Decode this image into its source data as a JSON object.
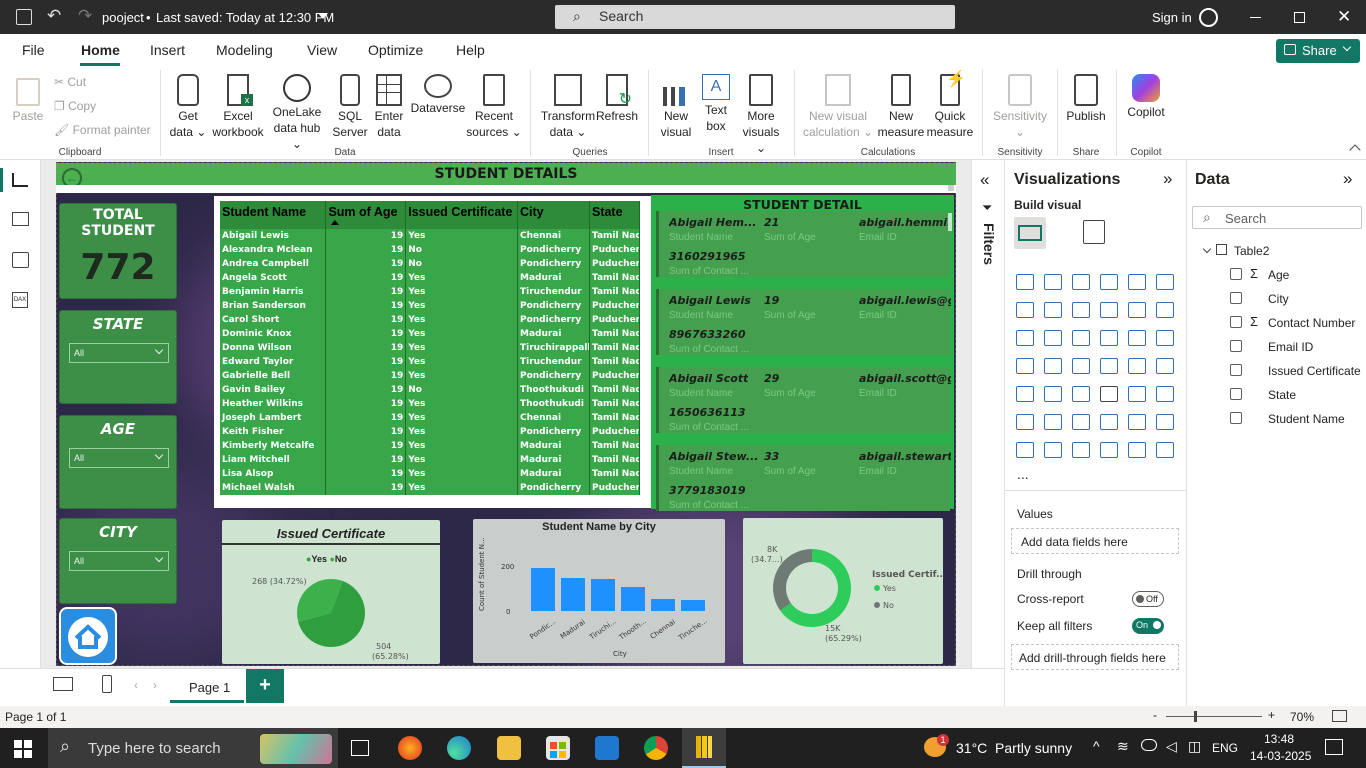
{
  "titlebar": {
    "file_name": "poojeсt",
    "saved_status": "Last saved: Today at 12:30 PM",
    "search_placeholder": "Search",
    "sign_in": "Sign in"
  },
  "menu": {
    "tabs": [
      "File",
      "Home",
      "Insert",
      "Modeling",
      "View",
      "Optimize",
      "Help"
    ],
    "active_tab": "Home",
    "share_label": "Share"
  },
  "ribbon": {
    "clipboard": {
      "paste": "Paste",
      "cut": "Cut",
      "copy": "Copy",
      "format_painter": "Format painter",
      "group": "Clipboard"
    },
    "data": {
      "get_data": [
        "Get",
        "data"
      ],
      "excel": [
        "Excel",
        "workbook"
      ],
      "onelake": [
        "OneLake",
        "data hub"
      ],
      "sql": [
        "SQL",
        "Server"
      ],
      "enter": [
        "Enter",
        "data"
      ],
      "dataverse": [
        "Dataverse"
      ],
      "recent": [
        "Recent",
        "sources"
      ],
      "group": "Data"
    },
    "queries": {
      "transform": [
        "Transform",
        "data"
      ],
      "refresh": [
        "Refresh"
      ],
      "group": "Queries"
    },
    "insert": {
      "new_visual": [
        "New",
        "visual"
      ],
      "text_box": [
        "Text",
        "box"
      ],
      "more_visuals": [
        "More",
        "visuals"
      ],
      "group": "Insert"
    },
    "calculations": {
      "new_visual_calc": [
        "New visual",
        "calculation"
      ],
      "new_measure": [
        "New",
        "measure"
      ],
      "quick_measure": [
        "Quick",
        "measure"
      ],
      "group": "Calculations"
    },
    "sensitivity": {
      "label": [
        "Sensitivity"
      ],
      "group": "Sensitivity"
    },
    "share": {
      "publish": [
        "Publish"
      ],
      "group": "Share"
    },
    "copilot": {
      "label": [
        "Copilot"
      ],
      "group": "Copilot"
    }
  },
  "report": {
    "header_title": "STUDENT DETAILS",
    "total_card": {
      "title_line1": "TOTAL",
      "title_line2": "STUDENT",
      "value": "772"
    },
    "slicers": [
      {
        "title": "STATE",
        "value": "All"
      },
      {
        "title": "AGE",
        "value": "All"
      },
      {
        "title": "CITY",
        "value": "All"
      }
    ],
    "table": {
      "columns": [
        "Student Name",
        "Sum of Age",
        "Issued Certificate",
        "City",
        "State"
      ],
      "rows": [
        [
          "Abigail Lewis",
          "19",
          "Yes",
          "Chennai",
          "Tamil Nadu"
        ],
        [
          "Alexandra Mclean",
          "19",
          "No",
          "Pondicherry",
          "Puducherry"
        ],
        [
          "Andrea Campbell",
          "19",
          "No",
          "Pondicherry",
          "Puducherry"
        ],
        [
          "Angela Scott",
          "19",
          "Yes",
          "Madurai",
          "Tamil Nadu"
        ],
        [
          "Benjamin Harris",
          "19",
          "Yes",
          "Tiruchendur",
          "Tamil Nadu"
        ],
        [
          "Brian Sanderson",
          "19",
          "Yes",
          "Pondicherry",
          "Puducherry"
        ],
        [
          "Carol Short",
          "19",
          "Yes",
          "Pondicherry",
          "Puducherry"
        ],
        [
          "Dominic Knox",
          "19",
          "Yes",
          "Madurai",
          "Tamil Nadu"
        ],
        [
          "Donna Wilson",
          "19",
          "Yes",
          "Tiruchirappalli",
          "Tamil Nadu"
        ],
        [
          "Edward Taylor",
          "19",
          "Yes",
          "Tiruchendur",
          "Tamil Nadu"
        ],
        [
          "Gabrielle Bell",
          "19",
          "Yes",
          "Pondicherry",
          "Puducherry"
        ],
        [
          "Gavin Bailey",
          "19",
          "No",
          "Thoothukudi",
          "Tamil Nadu"
        ],
        [
          "Heather Wilkins",
          "19",
          "Yes",
          "Thoothukudi",
          "Tamil Nadu"
        ],
        [
          "Joseph Lambert",
          "19",
          "Yes",
          "Chennai",
          "Tamil Nadu"
        ],
        [
          "Keith Fisher",
          "19",
          "Yes",
          "Pondicherry",
          "Puducherry"
        ],
        [
          "Kimberly Metcalfe",
          "19",
          "Yes",
          "Madurai",
          "Tamil Nadu"
        ],
        [
          "Liam Mitchell",
          "19",
          "Yes",
          "Madurai",
          "Tamil Nadu"
        ],
        [
          "Lisa Alsop",
          "19",
          "Yes",
          "Madurai",
          "Tamil Nadu"
        ],
        [
          "Michael Walsh",
          "19",
          "Yes",
          "Pondicherry",
          "Puducherry"
        ]
      ]
    },
    "detail": {
      "title": "STUDENT DETAIL",
      "labels": {
        "name": "Student Name",
        "age": "Sum of Age",
        "email": "Email ID",
        "contact": "Sum of Contact ..."
      },
      "cards": [
        {
          "name": "Abigail Hem...",
          "age": "21",
          "email": "abigail.hemmin...",
          "contact": "3160291965"
        },
        {
          "name": "Abigail Lewis",
          "age": "19",
          "email": "abigail.lewis@g...",
          "contact": "8967633260"
        },
        {
          "name": "Abigail Scott",
          "age": "29",
          "email": "abigail.scott@g...",
          "contact": "1650636113"
        },
        {
          "name": "Abigail Stew...",
          "age": "33",
          "email": "abigail.stewart...",
          "contact": "3779183019"
        }
      ]
    },
    "pie": {
      "title": "Issued Certificate",
      "legend": [
        "Yes",
        "No"
      ],
      "label_top": "268 (34.72%)",
      "label_bottom_1": "504",
      "label_bottom_2": "(65.28%)"
    },
    "bar_chart": {
      "title": "Student Name by City",
      "ylabel": "Count of Student N...",
      "xlabel": "City",
      "y_ticks": [
        "200",
        "0"
      ],
      "x_ticks": [
        "Pondic...",
        "Madurai",
        "Tiruchi...",
        "Thooth...",
        "Chennai",
        "Tiruche..."
      ]
    },
    "donut": {
      "legend_title": "Issued Certif...",
      "legend": [
        "Yes",
        "No"
      ],
      "label_top_1": "8K",
      "label_top_2": "(34.7...)",
      "label_bottom_1": "15K",
      "label_bottom_2": "(65.29%)"
    }
  },
  "chart_data": [
    {
      "type": "pie",
      "title": "Issued Certificate",
      "categories": [
        "Yes",
        "No"
      ],
      "values": [
        504,
        268
      ],
      "percent": [
        65.28,
        34.72
      ],
      "colors": [
        "#2e9e3e",
        "#3cb14b"
      ]
    },
    {
      "type": "bar",
      "title": "Student Name by City",
      "categories": [
        "Pondic...",
        "Madurai",
        "Tiruchi...",
        "Thooth...",
        "Chennai",
        "Tiruche..."
      ],
      "values": [
        215,
        165,
        160,
        120,
        60,
        55
      ],
      "ylim": [
        0,
        260
      ],
      "xlabel": "City",
      "ylabel": "Count of Student N...",
      "color": "#1e90ff"
    },
    {
      "type": "pie",
      "title": "",
      "categories": [
        "Yes",
        "No"
      ],
      "values": [
        15000,
        8000
      ],
      "percent": [
        65.29,
        34.7
      ],
      "colors": [
        "#2ecc5a",
        "#707a75"
      ]
    }
  ],
  "filters_pane": {
    "label": "Filters"
  },
  "viz_pane": {
    "title": "Visualizations",
    "build_visual": "Build visual",
    "values_label": "Values",
    "add_data_fields": "Add data fields here",
    "drill_through": "Drill through",
    "cross_report": "Cross-report",
    "cross_report_state": "Off",
    "keep_all_filters": "Keep all filters",
    "keep_all_filters_state": "On",
    "add_drill_fields": "Add drill-through fields here",
    "more": "..."
  },
  "data_pane": {
    "title": "Data",
    "search_placeholder": "Search",
    "table_name": "Table2",
    "fields": [
      {
        "name": "Age",
        "sigma": true
      },
      {
        "name": "City",
        "sigma": false
      },
      {
        "name": "Contact Number",
        "sigma": true
      },
      {
        "name": "Email ID",
        "sigma": false
      },
      {
        "name": "Issued Certificate",
        "sigma": false
      },
      {
        "name": "State",
        "sigma": false
      },
      {
        "name": "Student Name",
        "sigma": false
      }
    ]
  },
  "page_tabs": {
    "page1": "Page 1",
    "add": "+"
  },
  "status": {
    "page_info": "Page 1 of 1",
    "zoom": "70%"
  },
  "taskbar": {
    "search_placeholder": "Type here to search",
    "weather": "31°C  Partly sunny",
    "language": "ENG",
    "time": "13:48",
    "date": "14-03-2025",
    "notification_count": "1"
  },
  "colors": {
    "accent": "#117865",
    "report_green": "#4caf50",
    "card_green": "#3d8f48"
  }
}
